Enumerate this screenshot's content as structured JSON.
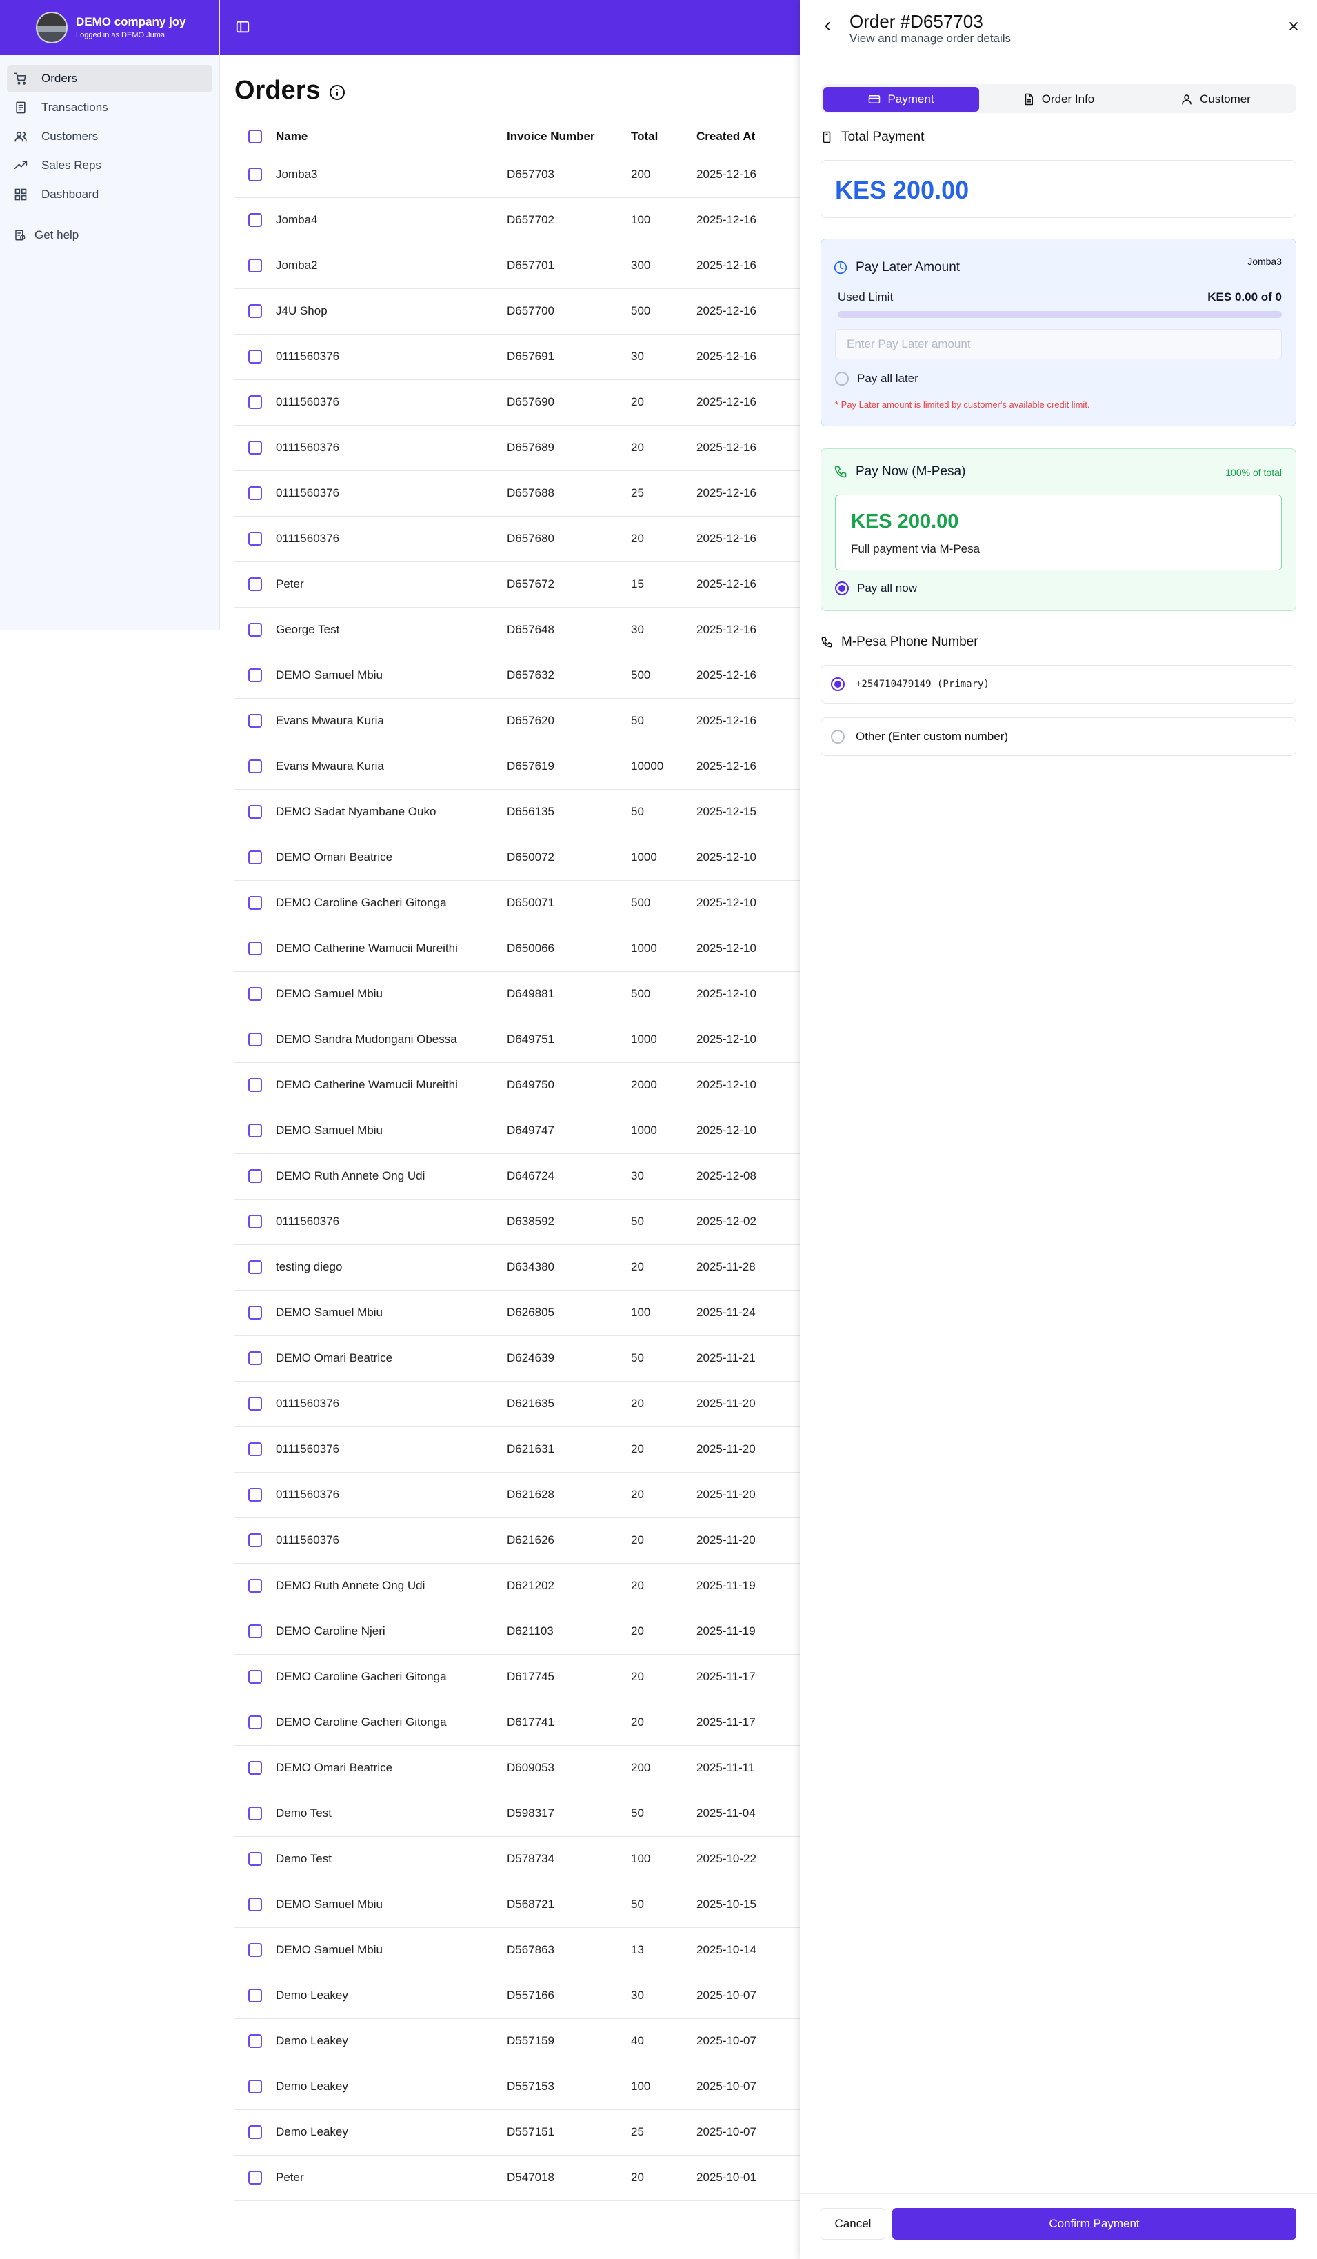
{
  "brand": {
    "company": "DEMO company joy",
    "logged_in": "Logged in as DEMO Juma"
  },
  "sidebar": {
    "items": [
      {
        "label": "Orders",
        "icon": "cart-icon"
      },
      {
        "label": "Transactions",
        "icon": "receipt-icon"
      },
      {
        "label": "Customers",
        "icon": "users-icon"
      },
      {
        "label": "Sales Reps",
        "icon": "trending-icon"
      },
      {
        "label": "Dashboard",
        "icon": "grid-icon"
      }
    ],
    "help": "Get help"
  },
  "main": {
    "title": "Orders",
    "columns": [
      "Name",
      "Invoice Number",
      "Total",
      "Created At"
    ],
    "rows": [
      [
        "Jomba3",
        "D657703",
        "200",
        "2025-12-16"
      ],
      [
        "Jomba4",
        "D657702",
        "100",
        "2025-12-16"
      ],
      [
        "Jomba2",
        "D657701",
        "300",
        "2025-12-16"
      ],
      [
        "J4U Shop",
        "D657700",
        "500",
        "2025-12-16"
      ],
      [
        "0111560376",
        "D657691",
        "30",
        "2025-12-16"
      ],
      [
        "0111560376",
        "D657690",
        "20",
        "2025-12-16"
      ],
      [
        "0111560376",
        "D657689",
        "20",
        "2025-12-16"
      ],
      [
        "0111560376",
        "D657688",
        "25",
        "2025-12-16"
      ],
      [
        "0111560376",
        "D657680",
        "20",
        "2025-12-16"
      ],
      [
        "Peter",
        "D657672",
        "15",
        "2025-12-16"
      ],
      [
        "George Test",
        "D657648",
        "30",
        "2025-12-16"
      ],
      [
        "DEMO Samuel Mbiu",
        "D657632",
        "500",
        "2025-12-16"
      ],
      [
        "Evans Mwaura Kuria",
        "D657620",
        "50",
        "2025-12-16"
      ],
      [
        "Evans Mwaura Kuria",
        "D657619",
        "10000",
        "2025-12-16"
      ],
      [
        "DEMO Sadat Nyambane Ouko",
        "D656135",
        "50",
        "2025-12-15"
      ],
      [
        "DEMO Omari Beatrice",
        "D650072",
        "1000",
        "2025-12-10"
      ],
      [
        "DEMO Caroline Gacheri Gitonga",
        "D650071",
        "500",
        "2025-12-10"
      ],
      [
        "DEMO Catherine Wamucii Mureithi",
        "D650066",
        "1000",
        "2025-12-10"
      ],
      [
        "DEMO Samuel Mbiu",
        "D649881",
        "500",
        "2025-12-10"
      ],
      [
        "DEMO Sandra Mudongani Obessa",
        "D649751",
        "1000",
        "2025-12-10"
      ],
      [
        "DEMO Catherine Wamucii Mureithi",
        "D649750",
        "2000",
        "2025-12-10"
      ],
      [
        "DEMO Samuel Mbiu",
        "D649747",
        "1000",
        "2025-12-10"
      ],
      [
        "DEMO Ruth Annete Ong Udi",
        "D646724",
        "30",
        "2025-12-08"
      ],
      [
        "0111560376",
        "D638592",
        "50",
        "2025-12-02"
      ],
      [
        "testing diego",
        "D634380",
        "20",
        "2025-11-28"
      ],
      [
        "DEMO Samuel Mbiu",
        "D626805",
        "100",
        "2025-11-24"
      ],
      [
        "DEMO Omari Beatrice",
        "D624639",
        "50",
        "2025-11-21"
      ],
      [
        "0111560376",
        "D621635",
        "20",
        "2025-11-20"
      ],
      [
        "0111560376",
        "D621631",
        "20",
        "2025-11-20"
      ],
      [
        "0111560376",
        "D621628",
        "20",
        "2025-11-20"
      ],
      [
        "0111560376",
        "D621626",
        "20",
        "2025-11-20"
      ],
      [
        "DEMO Ruth Annete Ong Udi",
        "D621202",
        "20",
        "2025-11-19"
      ],
      [
        "DEMO Caroline Njeri",
        "D621103",
        "20",
        "2025-11-19"
      ],
      [
        "DEMO Caroline Gacheri Gitonga",
        "D617745",
        "20",
        "2025-11-17"
      ],
      [
        "DEMO Caroline Gacheri Gitonga",
        "D617741",
        "20",
        "2025-11-17"
      ],
      [
        "DEMO Omari Beatrice",
        "D609053",
        "200",
        "2025-11-11"
      ],
      [
        "Demo Test",
        "D598317",
        "50",
        "2025-11-04"
      ],
      [
        "Demo Test",
        "D578734",
        "100",
        "2025-10-22"
      ],
      [
        "DEMO Samuel Mbiu",
        "D568721",
        "50",
        "2025-10-15"
      ],
      [
        "DEMO Samuel Mbiu",
        "D567863",
        "13",
        "2025-10-14"
      ],
      [
        "Demo Leakey",
        "D557166",
        "30",
        "2025-10-07"
      ],
      [
        "Demo Leakey",
        "D557159",
        "40",
        "2025-10-07"
      ],
      [
        "Demo Leakey",
        "D557153",
        "100",
        "2025-10-07"
      ],
      [
        "Demo Leakey",
        "D557151",
        "25",
        "2025-10-07"
      ],
      [
        "Peter",
        "D547018",
        "20",
        "2025-10-01"
      ]
    ]
  },
  "panel": {
    "title": "Order #D657703",
    "subtitle": "View and manage order details",
    "tabs": [
      {
        "label": "Payment",
        "active": true
      },
      {
        "label": "Order Info",
        "active": false
      },
      {
        "label": "Customer",
        "active": false
      }
    ],
    "total_payment": {
      "label": "Total Payment",
      "amount": "KES 200.00"
    },
    "pay_later": {
      "title": "Pay Later Amount",
      "customer": "Jomba3",
      "used_limit_label": "Used Limit",
      "used_limit_value": "KES 0.00 of 0",
      "used_limit_fraction": 0,
      "placeholder": "Enter Pay Later amount",
      "option": "Pay all later",
      "note": "* Pay Later amount is limited by customer's available credit limit."
    },
    "pay_now": {
      "title": "Pay Now (M-Pesa)",
      "percent": "100% of total",
      "amount": "KES 200.00",
      "desc": "Full payment via M-Pesa",
      "option": "Pay all now"
    },
    "mpesa": {
      "title": "M-Pesa Phone Number",
      "primary": "+254710479149 (Primary)",
      "other": "Other (Enter custom number)"
    },
    "footer": {
      "cancel": "Cancel",
      "confirm": "Confirm Payment"
    }
  },
  "colors": {
    "brand": "#5b2ee6",
    "blue": "#2563eb",
    "green": "#16a34a",
    "red": "#ef4444"
  }
}
